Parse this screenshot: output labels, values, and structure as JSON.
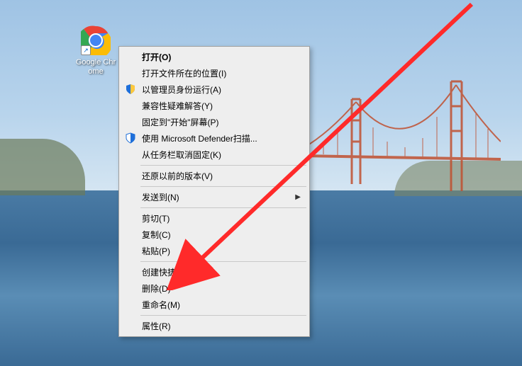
{
  "desktop": {
    "icon_label": "Google Chrome",
    "icon_name": "chrome-icon"
  },
  "context_menu": {
    "groups": [
      [
        {
          "label": "打开(O)",
          "bold": true,
          "icon": null,
          "submenu": false
        },
        {
          "label": "打开文件所在的位置(I)",
          "bold": false,
          "icon": null,
          "submenu": false
        },
        {
          "label": "以管理员身份运行(A)",
          "bold": false,
          "icon": "shield",
          "submenu": false
        },
        {
          "label": "兼容性疑难解答(Y)",
          "bold": false,
          "icon": null,
          "submenu": false
        },
        {
          "label": "固定到\"开始\"屏幕(P)",
          "bold": false,
          "icon": null,
          "submenu": false
        },
        {
          "label": "使用 Microsoft Defender扫描...",
          "bold": false,
          "icon": "defender",
          "submenu": false
        },
        {
          "label": "从任务栏取消固定(K)",
          "bold": false,
          "icon": null,
          "submenu": false
        }
      ],
      [
        {
          "label": "还原以前的版本(V)",
          "bold": false,
          "icon": null,
          "submenu": false
        }
      ],
      [
        {
          "label": "发送到(N)",
          "bold": false,
          "icon": null,
          "submenu": true
        }
      ],
      [
        {
          "label": "剪切(T)",
          "bold": false,
          "icon": null,
          "submenu": false
        },
        {
          "label": "复制(C)",
          "bold": false,
          "icon": null,
          "submenu": false
        },
        {
          "label": "粘贴(P)",
          "bold": false,
          "icon": null,
          "submenu": false
        }
      ],
      [
        {
          "label": "创建快捷方式(S)",
          "bold": false,
          "icon": null,
          "submenu": false
        },
        {
          "label": "删除(D)",
          "bold": false,
          "icon": null,
          "submenu": false
        },
        {
          "label": "重命名(M)",
          "bold": false,
          "icon": null,
          "submenu": false
        }
      ],
      [
        {
          "label": "属性(R)",
          "bold": false,
          "icon": null,
          "submenu": false
        }
      ]
    ]
  }
}
